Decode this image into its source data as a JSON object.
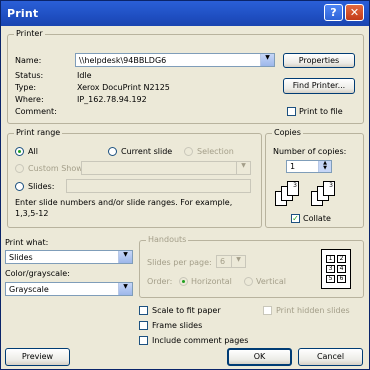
{
  "title": "Print",
  "title_buttons": {
    "help": "?",
    "close": "✕"
  },
  "printer": {
    "legend": "Printer",
    "name_label": "Name:",
    "name_value": "\\\\helpdesk\\94BBLDG6",
    "status_label": "Status:",
    "status_value": "Idle",
    "type_label": "Type:",
    "type_value": "Xerox DocuPrint N2125",
    "where_label": "Where:",
    "where_value": "IP_162.78.94.192",
    "comment_label": "Comment:",
    "comment_value": "",
    "properties": "Properties",
    "find_printer": "Find Printer...",
    "print_to_file": "Print to file"
  },
  "print_range": {
    "legend": "Print range",
    "all": "All",
    "current_slide": "Current slide",
    "selection": "Selection",
    "custom_show": "Custom Show:",
    "slides": "Slides:",
    "hint": "Enter slide numbers and/or slide ranges. For example,",
    "hint2": "1,3,5-12"
  },
  "copies": {
    "legend": "Copies",
    "number_label": "Number of copies:",
    "number_value": "1",
    "collate": "Collate",
    "page_labels": [
      "1",
      "2",
      "3",
      "1",
      "2",
      "3"
    ]
  },
  "print_what": {
    "label": "Print what:",
    "value": "Slides"
  },
  "color": {
    "label": "Color/grayscale:",
    "value": "Grayscale"
  },
  "handouts": {
    "legend": "Handouts",
    "slides_per_page_label": "Slides per page:",
    "slides_per_page_value": "6",
    "order_label": "Order:",
    "horizontal": "Horizontal",
    "vertical": "Vertical",
    "preview_labels": [
      "1",
      "2",
      "3",
      "4",
      "5",
      "6"
    ]
  },
  "options": {
    "scale_to_fit": "Scale to fit paper",
    "frame_slides": "Frame slides",
    "include_comment": "Include comment pages",
    "print_hidden": "Print hidden slides"
  },
  "buttons": {
    "preview": "Preview",
    "ok": "OK",
    "cancel": "Cancel"
  }
}
